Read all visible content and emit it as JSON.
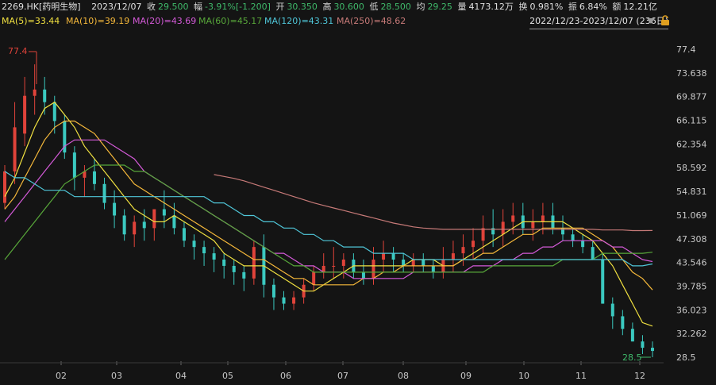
{
  "header": {
    "symbol": "2269.HK[药明生物]",
    "date": "2023/12/07",
    "close_label": "收",
    "close": "29.500",
    "amp_label": "幅",
    "amp": "-3.91%[-1.200]",
    "open_label": "开",
    "open": "30.350",
    "high_label": "高",
    "high": "30.600",
    "low_label": "低",
    "low": "28.500",
    "avg_label": "均",
    "avg": "29.25",
    "vol_label": "量",
    "vol": "4173.12万",
    "turn_label": "换",
    "turn": "0.981%",
    "swing_label": "振",
    "swing": "6.84%",
    "amount_label": "额",
    "amount": "12.21亿"
  },
  "ma_labels": [
    {
      "text": "MA(5)=33.44",
      "color": "#f0e040"
    },
    {
      "text": "MA(10)=39.19",
      "color": "#f5b83a"
    },
    {
      "text": "MA(20)=43.69",
      "color": "#d45ad8"
    },
    {
      "text": "MA(60)=45.17",
      "color": "#58a83a"
    },
    {
      "text": "MA(120)=43.31",
      "color": "#4fc6d8"
    },
    {
      "text": "MA(250)=48.62",
      "color": "#c77a78"
    }
  ],
  "range_text": "2022/12/23-2023/12/07 (236日)",
  "colors": {
    "up": "#e0433a",
    "down": "#3bc9c0",
    "bg": "#141414"
  },
  "chart_data": {
    "type": "candlestick",
    "title": "2269.HK[药明生物]",
    "x_tick_labels": [
      "02",
      "03",
      "04",
      "05",
      "06",
      "07",
      "08",
      "09",
      "10",
      "11",
      "12"
    ],
    "y_tick_labels": [
      "77.4",
      "73.638",
      "69.877",
      "66.115",
      "62.354",
      "58.592",
      "54.831",
      "51.069",
      "47.308",
      "43.546",
      "39.785",
      "36.023",
      "32.262",
      "28.5"
    ],
    "ylim": [
      28.5,
      77.4
    ],
    "max_marker": {
      "label": "77.4",
      "value": 77.4
    },
    "min_marker": {
      "label": "28.5",
      "value": 28.5
    },
    "series_ohlc_approx": {
      "t": [
        0,
        1,
        2,
        3,
        4,
        5,
        6,
        7,
        8,
        9,
        10,
        11,
        12,
        13,
        14,
        15,
        16,
        17,
        18,
        19,
        20,
        21,
        22,
        23,
        24,
        25,
        26,
        27,
        28,
        29,
        30,
        31,
        32,
        33,
        34,
        35,
        36,
        37,
        38,
        39,
        40,
        41,
        42,
        43,
        44,
        45,
        46,
        47,
        48,
        49,
        50,
        51,
        52,
        53,
        54,
        55,
        56,
        57,
        58,
        59,
        60,
        61,
        62,
        63,
        64,
        65
      ],
      "open": [
        53,
        58,
        64,
        70,
        71,
        69,
        66,
        61,
        57,
        58,
        56,
        53,
        51,
        48,
        50,
        49,
        52,
        51,
        49,
        47,
        46,
        45,
        44,
        43,
        42,
        41,
        46,
        40,
        38,
        37,
        38,
        40,
        42,
        43,
        43,
        44,
        42,
        41,
        44,
        45,
        44,
        43,
        44,
        43,
        42,
        44,
        45,
        46,
        47,
        49,
        48,
        50,
        51,
        49,
        50,
        51,
        49,
        48,
        47,
        46,
        44,
        37,
        35,
        33,
        31,
        30
      ],
      "high": [
        59,
        69,
        73,
        75,
        73,
        70,
        67,
        62,
        59,
        60,
        57,
        55,
        52,
        51,
        52,
        52,
        55,
        53,
        50,
        48,
        47,
        46,
        45,
        44,
        43,
        47,
        48,
        41,
        39,
        39,
        41,
        43,
        45,
        46,
        45,
        45,
        44,
        46,
        47,
        46,
        45,
        45,
        45,
        44,
        46,
        47,
        48,
        49,
        51,
        52,
        52,
        53,
        53,
        52,
        53,
        53,
        51,
        49,
        48,
        47,
        45,
        38,
        36,
        34,
        32,
        31
      ],
      "low": [
        52,
        56,
        62,
        67,
        67,
        64,
        60,
        55,
        54,
        55,
        52,
        49,
        47,
        46,
        47,
        47,
        49,
        48,
        46,
        44,
        43,
        42,
        41,
        40,
        39,
        40,
        38,
        36,
        36,
        36,
        37,
        39,
        41,
        41,
        41,
        41,
        40,
        40,
        42,
        42,
        42,
        42,
        42,
        41,
        41,
        42,
        43,
        44,
        45,
        46,
        46,
        48,
        48,
        47,
        48,
        48,
        47,
        46,
        45,
        44,
        37,
        33,
        32,
        31,
        29,
        28.5
      ],
      "close": [
        58,
        65,
        70,
        71,
        69,
        66,
        61,
        57,
        58,
        56,
        53,
        51,
        48,
        50,
        49,
        52,
        51,
        49,
        47,
        46,
        45,
        44,
        43,
        42,
        41,
        46,
        40,
        38,
        37,
        38,
        40,
        42,
        43,
        43,
        44,
        42,
        41,
        44,
        45,
        44,
        43,
        44,
        43,
        42,
        44,
        45,
        46,
        47,
        49,
        48,
        50,
        51,
        49,
        50,
        51,
        49,
        48,
        47,
        46,
        44,
        37,
        35,
        33,
        31,
        30,
        29.5
      ]
    },
    "series": [
      {
        "name": "MA(5)",
        "values": [
          54,
          57,
          61,
          65,
          68,
          69,
          67,
          65,
          62,
          60,
          58,
          56,
          54,
          52,
          51,
          50,
          50,
          51,
          50,
          49,
          48,
          47,
          45,
          44,
          43,
          43,
          43,
          42,
          41,
          40,
          39,
          39,
          40,
          41,
          42,
          43,
          43,
          43,
          43,
          43,
          43,
          44,
          44,
          44,
          43,
          43,
          44,
          45,
          46,
          47,
          48,
          49,
          50,
          50,
          50,
          50,
          50,
          49,
          48,
          47,
          45,
          43,
          40,
          37,
          34,
          33.44
        ]
      },
      {
        "name": "MA(10)",
        "values": [
          52,
          54,
          57,
          60,
          63,
          65,
          66,
          66,
          65,
          64,
          62,
          60,
          58,
          56,
          55,
          54,
          53,
          52,
          51,
          50,
          49,
          48,
          47,
          46,
          45,
          44,
          44,
          43,
          42,
          41,
          41,
          40,
          40,
          40,
          40,
          40,
          41,
          41,
          42,
          42,
          43,
          43,
          43,
          43,
          43,
          43,
          44,
          44,
          45,
          45,
          46,
          47,
          48,
          48,
          49,
          49,
          49,
          49,
          49,
          48,
          47,
          46,
          44,
          42,
          41,
          39.19
        ]
      },
      {
        "name": "MA(20)",
        "values": [
          50,
          52,
          54,
          56,
          58,
          60,
          62,
          63,
          63,
          63,
          63,
          62,
          61,
          60,
          58,
          57,
          56,
          55,
          54,
          53,
          52,
          51,
          50,
          49,
          48,
          47,
          46,
          45,
          45,
          44,
          43,
          43,
          42,
          42,
          42,
          41,
          41,
          41,
          41,
          41,
          41,
          42,
          42,
          42,
          42,
          42,
          42,
          43,
          43,
          43,
          44,
          44,
          45,
          45,
          46,
          46,
          47,
          47,
          47,
          47,
          47,
          46,
          46,
          45,
          44,
          43.69
        ]
      },
      {
        "name": "MA(60)",
        "values": [
          44,
          46,
          48,
          50,
          52,
          54,
          56,
          57,
          58,
          59,
          59,
          59,
          59,
          58,
          58,
          57,
          56,
          55,
          54,
          53,
          52,
          51,
          50,
          49,
          48,
          47,
          46,
          45,
          44,
          43,
          43,
          42,
          42,
          42,
          42,
          42,
          42,
          42,
          42,
          42,
          42,
          42,
          42,
          42,
          42,
          42,
          42,
          42,
          42,
          43,
          43,
          43,
          43,
          43,
          43,
          43,
          44,
          44,
          44,
          44,
          45,
          45,
          45,
          45,
          45,
          45.17
        ]
      },
      {
        "name": "MA(120)",
        "values": [
          58,
          57,
          57,
          56,
          55,
          55,
          55,
          54,
          54,
          54,
          54,
          54,
          54,
          54,
          54,
          54,
          54,
          54,
          54,
          54,
          54,
          53,
          53,
          52,
          51,
          51,
          50,
          50,
          49,
          49,
          48,
          48,
          47,
          47,
          46,
          46,
          46,
          45,
          45,
          45,
          45,
          44,
          44,
          44,
          44,
          44,
          44,
          44,
          44,
          44,
          44,
          44,
          44,
          44,
          44,
          44,
          44,
          44,
          44,
          44,
          44,
          44,
          44,
          43,
          43,
          43.31
        ]
      },
      {
        "name": "MA(250)",
        "values": [
          null,
          null,
          null,
          null,
          null,
          null,
          null,
          null,
          null,
          null,
          null,
          null,
          null,
          null,
          null,
          null,
          null,
          null,
          null,
          null,
          null,
          57.5,
          57.2,
          56.9,
          56.5,
          56,
          55.5,
          55,
          54.5,
          54,
          53.5,
          53,
          52.6,
          52.2,
          51.8,
          51.4,
          51,
          50.6,
          50.2,
          49.8,
          49.5,
          49.2,
          49,
          48.9,
          48.8,
          48.8,
          48.8,
          48.8,
          48.8,
          48.8,
          48.8,
          48.8,
          48.8,
          48.8,
          48.8,
          48.8,
          48.8,
          48.8,
          48.8,
          48.8,
          48.7,
          48.7,
          48.7,
          48.6,
          48.6,
          48.62
        ]
      }
    ]
  }
}
